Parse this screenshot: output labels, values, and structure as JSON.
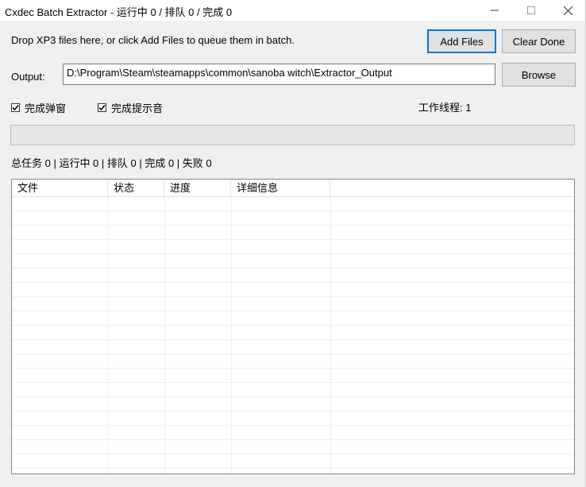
{
  "window": {
    "title": "Cxdec Batch Extractor - 运行中 0 / 排队 0 / 完成 0"
  },
  "hint_text": "Drop XP3 files here, or click Add Files to queue them in batch.",
  "buttons": {
    "add_files": "Add Files",
    "clear_done": "Clear Done",
    "browse": "Browse"
  },
  "output": {
    "label": "Output:",
    "value": "D:\\Program\\Steam\\steamapps\\common\\sanoba witch\\Extractor_Output"
  },
  "options": {
    "popup_label": "完成弹窗",
    "popup_checked": true,
    "sound_label": "完成提示音",
    "sound_checked": true
  },
  "threads_text": "工作线程: 1",
  "progress": {
    "value_percent": 0
  },
  "summary_text": "总任务 0 | 运行中 0 | 排队 0 | 完成 0 | 失败 0",
  "table": {
    "columns": [
      "文件",
      "状态",
      "进度",
      "详细信息"
    ],
    "rows": []
  },
  "colors": {
    "accent": "#0078d7",
    "progress": "#06b025"
  }
}
